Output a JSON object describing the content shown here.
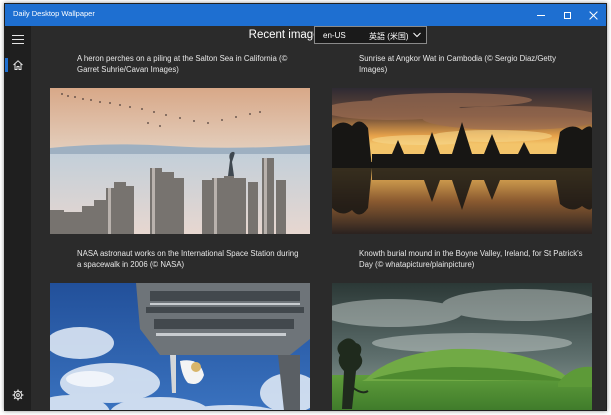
{
  "window": {
    "title": "Daily Desktop Wallpaper"
  },
  "page": {
    "title": "Recent images"
  },
  "language": {
    "code": "en-US",
    "name": "英語 (米国)"
  },
  "icons": {
    "menu": "hamburger-icon",
    "home": "home-icon",
    "settings": "gear-icon",
    "dropdown": "chevron-down-icon"
  },
  "images": [
    {
      "caption": "A heron perches on a piling at the Salton Sea in California (© Garret Suhrie/Cavan Images)"
    },
    {
      "caption": "Sunrise at Angkor Wat in Cambodia (© Sergio Diaz/Getty Images)"
    },
    {
      "caption": "NASA astronaut works on the International Space Station during a spacewalk in 2006 (© NASA)"
    },
    {
      "caption": "Knowth burial mound in the Boyne Valley, Ireland, for St Patrick's Day (© whatapicture/plainpicture)"
    }
  ],
  "colors": {
    "accent": "#1e6fd1",
    "background": "#2b2b2b",
    "sidebar": "#1f1f1f"
  }
}
